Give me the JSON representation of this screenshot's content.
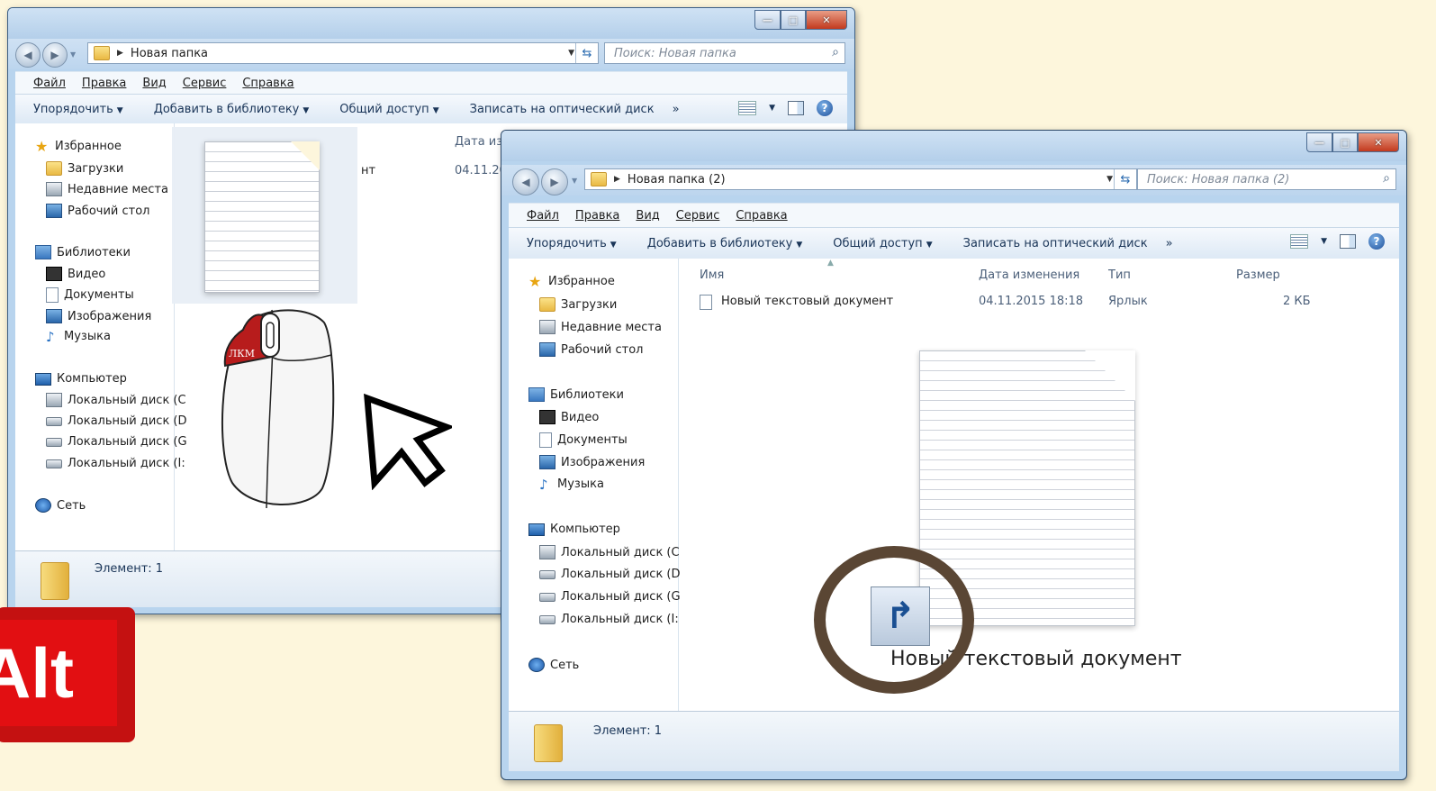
{
  "window1": {
    "address": "Новая папка",
    "search_placeholder": "Поиск: Новая папка",
    "menu": [
      "Файл",
      "Правка",
      "Вид",
      "Сервис",
      "Справка"
    ],
    "commands": [
      "Упорядочить",
      "Добавить в библиотеку",
      "Общий доступ",
      "Записать на оптический диск"
    ],
    "more_label": "»",
    "column_date_partial": "Дата изм",
    "file_name_partial": "нт",
    "file_date_partial": "04.11.201",
    "nav": {
      "favorites": "Избранное",
      "downloads": "Загрузки",
      "recent": "Недавние места",
      "desktop": "Рабочий стол",
      "libraries": "Библиотеки",
      "video": "Видео",
      "documents": "Документы",
      "images": "Изображения",
      "music": "Музыка",
      "computer": "Компьютер",
      "disk_c": "Локальный диск (C",
      "disk_d": "Локальный диск (D",
      "disk_g": "Локальный диск (G",
      "disk_i": "Локальный диск (I:",
      "network": "Сеть"
    },
    "status": "Элемент: 1"
  },
  "window2": {
    "address": "Новая папка (2)",
    "search_placeholder": "Поиск: Новая папка (2)",
    "menu": [
      "Файл",
      "Правка",
      "Вид",
      "Сервис",
      "Справка"
    ],
    "commands": [
      "Упорядочить",
      "Добавить в библиотеку",
      "Общий доступ",
      "Записать на оптический диск"
    ],
    "more_label": "»",
    "columns": {
      "name": "Имя",
      "date": "Дата изменения",
      "type": "Тип",
      "size": "Размер"
    },
    "file": {
      "name": "Новый текстовый документ",
      "date": "04.11.2015 18:18",
      "type": "Ярлык",
      "size": "2 КБ"
    },
    "drag_label": "Новый текстовый документ",
    "nav": {
      "favorites": "Избранное",
      "downloads": "Загрузки",
      "recent": "Недавние места",
      "desktop": "Рабочий стол",
      "libraries": "Библиотеки",
      "video": "Видео",
      "documents": "Документы",
      "images": "Изображения",
      "music": "Музыка",
      "computer": "Компьютер",
      "disk_c": "Локальный диск (C",
      "disk_d": "Локальный диск (D",
      "disk_g": "Локальный диск (G",
      "disk_i": "Локальный диск (I:",
      "network": "Сеть"
    },
    "status": "Элемент: 1"
  },
  "mouse_label": "ЛКМ",
  "alt_key_label": "Alt"
}
